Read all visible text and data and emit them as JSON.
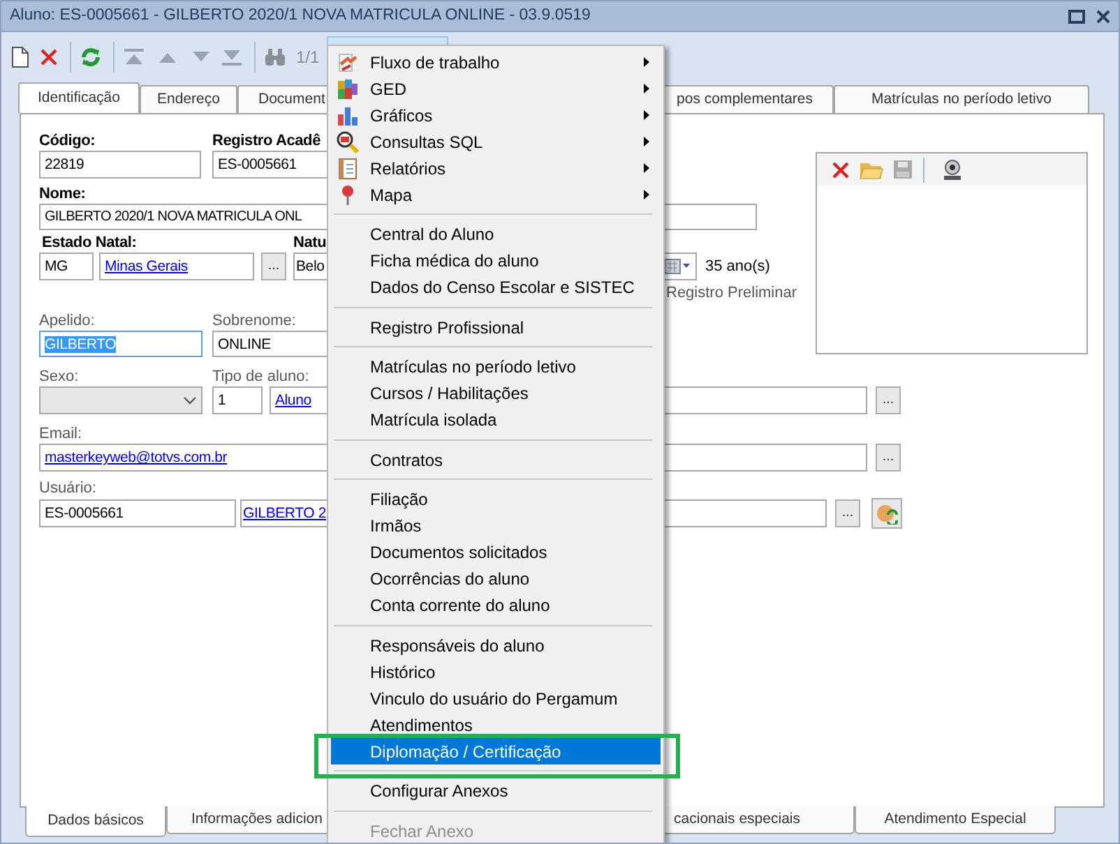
{
  "window": {
    "title": "Aluno: ES-0005661 - GILBERTO 2020/1 NOVA MATRICULA ONLINE - 03.9.0519"
  },
  "toolbar": {
    "record_counter": "1/1"
  },
  "tabs": [
    {
      "label": "Identificação",
      "selected": true
    },
    {
      "label": "Endereço",
      "selected": false
    },
    {
      "label": "Document",
      "selected": false
    },
    {
      "label": "pos complementares",
      "selected": false
    },
    {
      "label": "Matrículas no período letivo",
      "selected": false
    }
  ],
  "form": {
    "codigo": {
      "label": "Código:",
      "value": "22819"
    },
    "registro": {
      "label": "Registro Acadê",
      "value": "ES-0005661"
    },
    "nome": {
      "label": "Nome:",
      "value": "GILBERTO 2020/1 NOVA MATRICULA ONL"
    },
    "estado_natal": {
      "label": "Estado Natal:",
      "uf": "MG",
      "name": "Minas Gerais",
      "browse": "..."
    },
    "naturalidade": {
      "label": "Natu",
      "value": "Belo"
    },
    "age": "35 ano(s)",
    "preliminary_register": "Registro Preliminar",
    "apelido": {
      "label": "Apelido:",
      "value": "GILBERTO",
      "text_selected": true
    },
    "sobrenome": {
      "label": "Sobrenome:",
      "value": "ONLINE"
    },
    "sexo": {
      "label": "Sexo:",
      "disabled": true
    },
    "tipo_aluno": {
      "label": "Tipo de aluno:",
      "code": "1",
      "name": "Aluno",
      "browse": "..."
    },
    "email": {
      "label": "Email:",
      "value": "masterkeyweb@totvs.com.br",
      "browse": "..."
    },
    "usuario": {
      "label": "Usuário:",
      "code": "ES-0005661",
      "name": "GILBERTO 2",
      "browse": "..."
    }
  },
  "bottom_tabs": [
    {
      "label": "Dados básicos",
      "selected": true
    },
    {
      "label": "Informações adicion",
      "selected": false
    },
    {
      "label": "cacionais especiais",
      "selected": false
    },
    {
      "label": "Atendimento Especial",
      "selected": false
    }
  ],
  "context_menu": [
    {
      "kind": "item",
      "label": "Fluxo de trabalho",
      "submenu": true,
      "selected": false,
      "disabled": false
    },
    {
      "kind": "item",
      "label": "GED",
      "submenu": true,
      "selected": false,
      "disabled": false
    },
    {
      "kind": "item",
      "label": "Gráficos",
      "submenu": true,
      "selected": false,
      "disabled": false
    },
    {
      "kind": "item",
      "label": "Consultas SQL",
      "submenu": true,
      "selected": false,
      "disabled": false
    },
    {
      "kind": "item",
      "label": "Relatórios",
      "submenu": true,
      "selected": false,
      "disabled": false
    },
    {
      "kind": "item",
      "label": "Mapa",
      "submenu": true,
      "selected": false,
      "disabled": false
    },
    {
      "kind": "separator"
    },
    {
      "kind": "item",
      "label": "Central do Aluno",
      "submenu": false,
      "selected": false,
      "disabled": false
    },
    {
      "kind": "item",
      "label": "Ficha médica do aluno",
      "submenu": false,
      "selected": false,
      "disabled": false
    },
    {
      "kind": "item",
      "label": "Dados do Censo Escolar e SISTEC",
      "submenu": false,
      "selected": false,
      "disabled": false
    },
    {
      "kind": "separator"
    },
    {
      "kind": "item",
      "label": "Registro Profissional",
      "submenu": false,
      "selected": false,
      "disabled": false
    },
    {
      "kind": "separator"
    },
    {
      "kind": "item",
      "label": "Matrículas no período letivo",
      "submenu": false,
      "selected": false,
      "disabled": false
    },
    {
      "kind": "item",
      "label": "Cursos / Habilitações",
      "submenu": false,
      "selected": false,
      "disabled": false
    },
    {
      "kind": "item",
      "label": "Matrícula isolada",
      "submenu": false,
      "selected": false,
      "disabled": false
    },
    {
      "kind": "separator"
    },
    {
      "kind": "item",
      "label": "Contratos",
      "submenu": false,
      "selected": false,
      "disabled": false
    },
    {
      "kind": "separator"
    },
    {
      "kind": "item",
      "label": "Filiação",
      "submenu": false,
      "selected": false,
      "disabled": false
    },
    {
      "kind": "item",
      "label": "Irmãos",
      "submenu": false,
      "selected": false,
      "disabled": false
    },
    {
      "kind": "item",
      "label": "Documentos solicitados",
      "submenu": false,
      "selected": false,
      "disabled": false
    },
    {
      "kind": "item",
      "label": "Ocorrências do aluno",
      "submenu": false,
      "selected": false,
      "disabled": false
    },
    {
      "kind": "item",
      "label": "Conta corrente do aluno",
      "submenu": false,
      "selected": false,
      "disabled": false
    },
    {
      "kind": "separator"
    },
    {
      "kind": "item",
      "label": "Responsáveis do aluno",
      "submenu": false,
      "selected": false,
      "disabled": false
    },
    {
      "kind": "item",
      "label": "Histórico",
      "submenu": false,
      "selected": false,
      "disabled": false
    },
    {
      "kind": "item",
      "label": "Vinculo do usuário do Pergamum",
      "submenu": false,
      "selected": false,
      "disabled": false
    },
    {
      "kind": "item",
      "label": "Atendimentos",
      "submenu": false,
      "selected": false,
      "disabled": false
    },
    {
      "kind": "item",
      "label": "Diplomação / Certificação",
      "submenu": false,
      "selected": true,
      "disabled": false
    },
    {
      "kind": "separator"
    },
    {
      "kind": "item",
      "label": "Configurar Anexos",
      "submenu": false,
      "selected": false,
      "disabled": false
    },
    {
      "kind": "separator"
    },
    {
      "kind": "item",
      "label": "Fechar Anexo",
      "submenu": false,
      "selected": false,
      "disabled": true
    }
  ]
}
